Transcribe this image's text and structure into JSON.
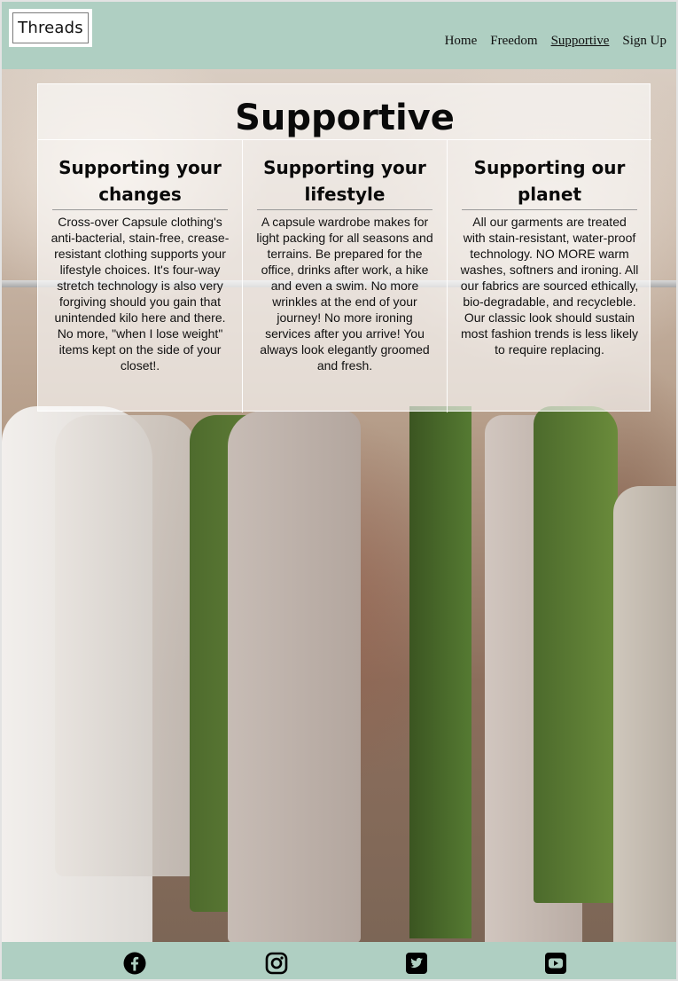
{
  "header": {
    "logo": "Threads",
    "nav": [
      {
        "label": "Home",
        "active": false
      },
      {
        "label": "Freedom",
        "active": false
      },
      {
        "label": "Supportive",
        "active": true
      },
      {
        "label": "Sign Up",
        "active": false
      }
    ]
  },
  "main": {
    "title": "Supportive",
    "columns": [
      {
        "heading": "Supporting your changes",
        "body": "Cross-over Capsule clothing's anti-bacterial, stain-free, crease-resistant clothing supports your lifestyle choices. It's four-way stretch technology is also very forgiving should you gain that unintended kilo here and there. No more, \"when I lose weight\" items kept on the side of your closet!."
      },
      {
        "heading": "Supporting your lifestyle",
        "body": "A capsule wardrobe makes for light packing for all seasons and terrains. Be prepared for the office, drinks after work, a hike and even a swim. No more wrinkles at the end of your journey! No more ironing services after you arrive! You always look elegantly groomed and fresh."
      },
      {
        "heading": "Supporting our planet",
        "body": "All our garments are treated with stain-resistant, water-proof technology. NO MORE warm washes, softners and ironing. All our fabrics are sourced ethically, bio-degradable, and recycleble. Our classic look should sustain most fashion trends is less likely to require replacing."
      }
    ]
  },
  "footer": {
    "social_icons": [
      "facebook-icon",
      "instagram-icon",
      "twitter-icon",
      "youtube-icon"
    ]
  },
  "colors": {
    "header_bg": "#afcfc2",
    "footer_bg": "#afcfc2",
    "card_bg": "rgba(255,255,255,0.62)"
  }
}
